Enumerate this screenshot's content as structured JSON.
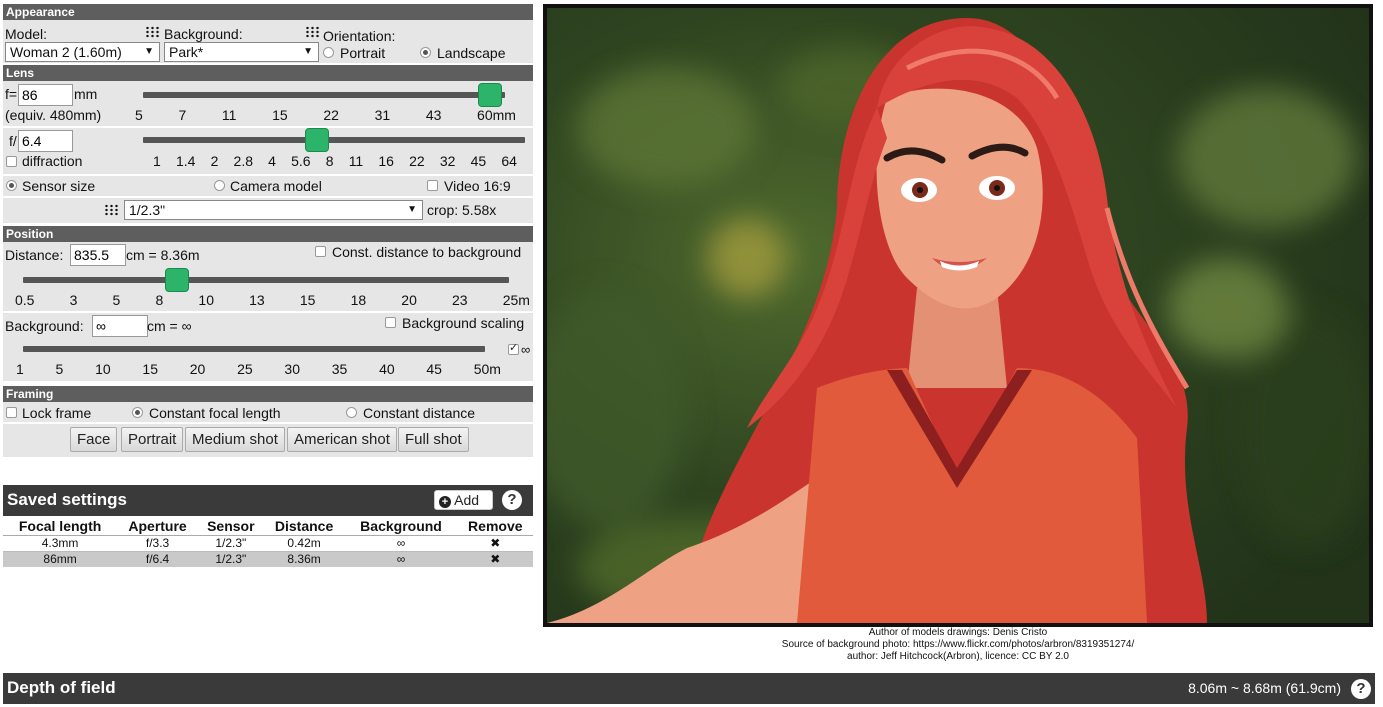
{
  "appearance": {
    "header": "Appearance",
    "model_label": "Model:",
    "model_value": "Woman 2 (1.60m)",
    "background_label": "Background:",
    "background_value": "Park*",
    "orientation_label": "Orientation:",
    "portrait_label": "Portrait",
    "landscape_label": "Landscape",
    "selected_orientation": "Landscape"
  },
  "lens": {
    "header": "Lens",
    "f_prefix": "f=",
    "focal_value": "86",
    "focal_unit": "mm",
    "equiv_text": "(equiv. 480mm)",
    "focal_ticks": [
      "5",
      "7",
      "11",
      "15",
      "22",
      "31",
      "43",
      "60mm"
    ],
    "focal_slider_fraction": 1.0,
    "aperture_prefix": "f/",
    "aperture_value": "6.4",
    "diffraction_label": "diffraction",
    "diffraction_checked": false,
    "aperture_ticks": [
      "1",
      "1.4",
      "2",
      "2.8",
      "4",
      "5.6",
      "8",
      "11",
      "16",
      "22",
      "32",
      "45",
      "64"
    ],
    "aperture_slider_fraction": 0.46,
    "sensor_size_label": "Sensor size",
    "camera_model_label": "Camera model",
    "video_label": "Video 16:9",
    "sensor_value": "1/2.3\"",
    "crop_text": "crop: 5.58x"
  },
  "position": {
    "header": "Position",
    "distance_label": "Distance:",
    "distance_value": "835.5",
    "distance_suffix": "cm = 8.36m",
    "const_dist_label": "Const. distance to background",
    "distance_ticks": [
      "0.5",
      "3",
      "5",
      "8",
      "10",
      "13",
      "15",
      "18",
      "20",
      "23",
      "25m"
    ],
    "distance_slider_fraction": 0.33,
    "background_label": "Background:",
    "background_value": "∞",
    "background_suffix": "cm = ∞",
    "bg_scaling_label": "Background scaling",
    "bg_ticks": [
      "1",
      "5",
      "10",
      "15",
      "20",
      "25",
      "30",
      "35",
      "40",
      "45",
      "50m"
    ],
    "infinity_label": "∞",
    "infinity_checked": true
  },
  "framing": {
    "header": "Framing",
    "lock_frame_label": "Lock frame",
    "const_focal_label": "Constant focal length",
    "const_distance_label": "Constant distance",
    "buttons": [
      "Face",
      "Portrait",
      "Medium shot",
      "American shot",
      "Full shot"
    ]
  },
  "saved": {
    "title": "Saved settings",
    "add_label": "Add",
    "help": "?",
    "columns": [
      "Focal length",
      "Aperture",
      "Sensor",
      "Distance",
      "Background",
      "Remove"
    ],
    "rows": [
      [
        "4.3mm",
        "f/3.3",
        "1/2.3\"",
        "0.42m",
        "∞",
        "✖"
      ],
      [
        "86mm",
        "f/6.4",
        "1/2.3\"",
        "8.36m",
        "∞",
        "✖"
      ]
    ]
  },
  "credits": {
    "line1": "Author of models drawings: Denis Cristo",
    "line2": "Source of background photo: https://www.flickr.com/photos/arbron/8319351274/",
    "line3": "author: Jeff Hitchcock(Arbron), licence: CC BY 2.0"
  },
  "dof": {
    "title": "Depth of field",
    "value": "8.06m ~ 8.68m (61.9cm)",
    "help": "?"
  },
  "colors": {
    "slider_thumb": "#2bb46a",
    "section_header": "#5e5e5e",
    "dark_bar": "#3a3a3a",
    "hair": "#d8423a",
    "skin": "#efa283",
    "shirt": "#e25a3c"
  }
}
